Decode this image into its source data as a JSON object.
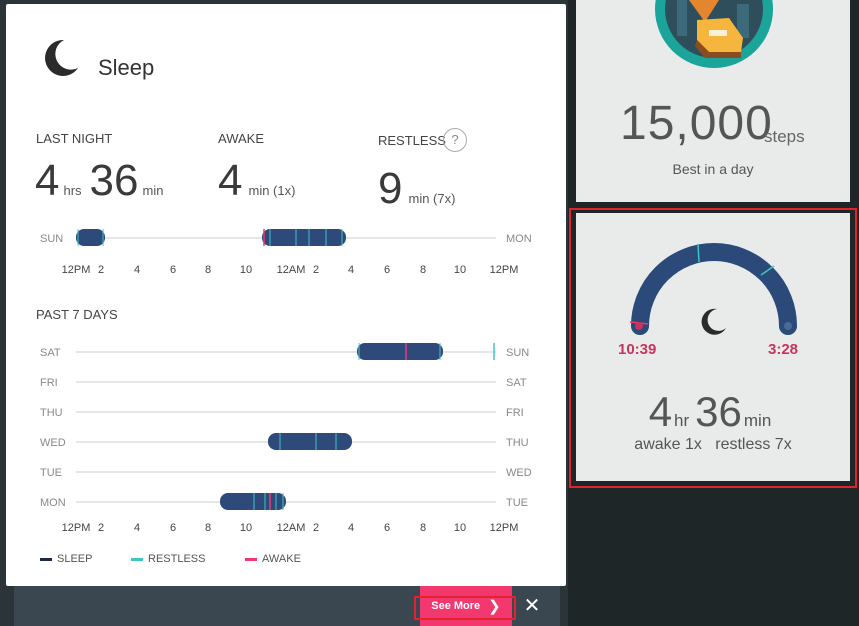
{
  "modal": {
    "title": "Sleep",
    "stats": {
      "last_night": {
        "label": "LAST NIGHT",
        "hrs": "4",
        "hrs_unit": "hrs",
        "min": "36",
        "min_unit": "min"
      },
      "awake": {
        "label": "AWAKE",
        "value": "4",
        "unit": "min (1x)"
      },
      "restless": {
        "label": "RESTLESS",
        "value": "9",
        "unit": "min (7x)",
        "help": "?"
      }
    },
    "last_night_chart": {
      "left_day": "SUN",
      "right_day": "MON",
      "ticks": [
        "12PM",
        "2",
        "4",
        "6",
        "8",
        "10",
        "12AM",
        "2",
        "4",
        "6",
        "8",
        "10",
        "12PM"
      ]
    },
    "past7": {
      "label": "PAST 7 DAYS",
      "rows": [
        {
          "left": "SAT",
          "right": "SUN"
        },
        {
          "left": "FRI",
          "right": "SAT"
        },
        {
          "left": "THU",
          "right": "FRI"
        },
        {
          "left": "WED",
          "right": "THU"
        },
        {
          "left": "TUE",
          "right": "WED"
        },
        {
          "left": "MON",
          "right": "TUE"
        }
      ],
      "ticks": [
        "12PM",
        "2",
        "4",
        "6",
        "8",
        "10",
        "12AM",
        "2",
        "4",
        "6",
        "8",
        "10",
        "12PM"
      ]
    },
    "legend": [
      {
        "label": "SLEEP",
        "color": "#1f2a44"
      },
      {
        "label": "RESTLESS",
        "color": "#3ec6c6"
      },
      {
        "label": "AWAKE",
        "color": "#f2386f"
      }
    ]
  },
  "footer": {
    "see_more": "See More",
    "close": "✕"
  },
  "tiles": {
    "steps": {
      "value": "15,000",
      "unit": "steps",
      "caption": "Best in a day"
    },
    "sleep": {
      "start": "10:39",
      "end": "3:28",
      "hr": "4",
      "hr_unit": "hr",
      "min": "36",
      "min_unit": "min",
      "awake": "awake 1x",
      "restless": "restless 7x"
    }
  },
  "colors": {
    "sleep_bar": "#2e4a7a",
    "accent_pink": "#f2386f",
    "teal": "#1aa49a",
    "restless": "#3ec6c6"
  }
}
